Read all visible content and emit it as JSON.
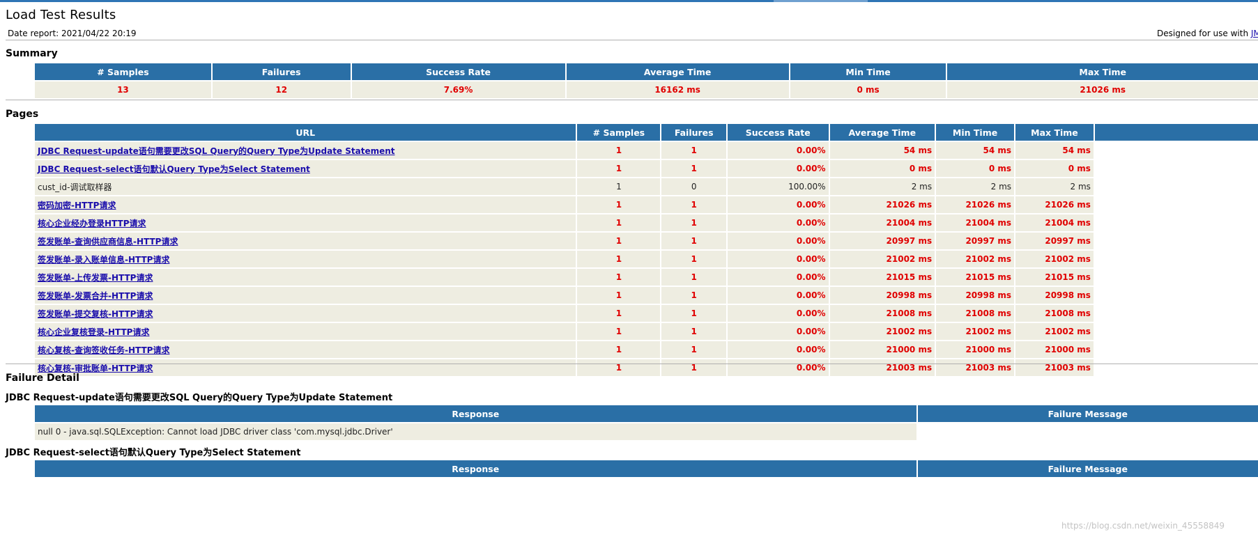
{
  "header": {
    "title": "Load Test Results",
    "date_report": "Date report: 2021/04/22 20:19",
    "designed_prefix": "Designed for use with ",
    "designed_link": "JM"
  },
  "summary": {
    "heading": "Summary",
    "columns": [
      "# Samples",
      "Failures",
      "Success Rate",
      "Average Time",
      "Min Time",
      "Max Time"
    ],
    "values": [
      "13",
      "12",
      "7.69%",
      "16162 ms",
      "0 ms",
      "21026 ms"
    ]
  },
  "pages": {
    "heading": "Pages",
    "columns": [
      "URL",
      "# Samples",
      "Failures",
      "Success Rate",
      "Average Time",
      "Min Time",
      "Max Time"
    ],
    "rows": [
      {
        "url": "JDBC Request-update语句需要更改SQL Query的Query Type为Update Statement",
        "samples": "1",
        "failures": "1",
        "success_rate": "0.00%",
        "avg": "54 ms",
        "min": "54 ms",
        "max": "54 ms",
        "failed": true
      },
      {
        "url": "JDBC Request-select语句默认Query Type为Select Statement",
        "samples": "1",
        "failures": "1",
        "success_rate": "0.00%",
        "avg": "0 ms",
        "min": "0 ms",
        "max": "0 ms",
        "failed": true
      },
      {
        "url": "cust_id-调试取样器",
        "samples": "1",
        "failures": "0",
        "success_rate": "100.00%",
        "avg": "2 ms",
        "min": "2 ms",
        "max": "2 ms",
        "failed": false
      },
      {
        "url": "密码加密-HTTP请求",
        "samples": "1",
        "failures": "1",
        "success_rate": "0.00%",
        "avg": "21026 ms",
        "min": "21026 ms",
        "max": "21026 ms",
        "failed": true
      },
      {
        "url": "核心企业经办登录HTTP请求",
        "samples": "1",
        "failures": "1",
        "success_rate": "0.00%",
        "avg": "21004 ms",
        "min": "21004 ms",
        "max": "21004 ms",
        "failed": true
      },
      {
        "url": "签发账单-查询供应商信息-HTTP请求",
        "samples": "1",
        "failures": "1",
        "success_rate": "0.00%",
        "avg": "20997 ms",
        "min": "20997 ms",
        "max": "20997 ms",
        "failed": true
      },
      {
        "url": "签发账单-录入账单信息-HTTP请求",
        "samples": "1",
        "failures": "1",
        "success_rate": "0.00%",
        "avg": "21002 ms",
        "min": "21002 ms",
        "max": "21002 ms",
        "failed": true
      },
      {
        "url": "签发账单-上传发票-HTTP请求",
        "samples": "1",
        "failures": "1",
        "success_rate": "0.00%",
        "avg": "21015 ms",
        "min": "21015 ms",
        "max": "21015 ms",
        "failed": true
      },
      {
        "url": "签发账单-发票合并-HTTP请求",
        "samples": "1",
        "failures": "1",
        "success_rate": "0.00%",
        "avg": "20998 ms",
        "min": "20998 ms",
        "max": "20998 ms",
        "failed": true
      },
      {
        "url": "签发账单-提交复核-HTTP请求",
        "samples": "1",
        "failures": "1",
        "success_rate": "0.00%",
        "avg": "21008 ms",
        "min": "21008 ms",
        "max": "21008 ms",
        "failed": true
      },
      {
        "url": "核心企业复核登录-HTTP请求",
        "samples": "1",
        "failures": "1",
        "success_rate": "0.00%",
        "avg": "21002 ms",
        "min": "21002 ms",
        "max": "21002 ms",
        "failed": true
      },
      {
        "url": "核心复核-查询签收任务-HTTP请求",
        "samples": "1",
        "failures": "1",
        "success_rate": "0.00%",
        "avg": "21000 ms",
        "min": "21000 ms",
        "max": "21000 ms",
        "failed": true
      },
      {
        "url": "核心复核-审批账单-HTTP请求",
        "samples": "1",
        "failures": "1",
        "success_rate": "0.00%",
        "avg": "21003 ms",
        "min": "21003 ms",
        "max": "21003 ms",
        "failed": true
      }
    ]
  },
  "failure_detail": {
    "heading": "Failure Detail",
    "groups": [
      {
        "title": "JDBC Request-update语句需要更改SQL Query的Query Type为Update Statement",
        "columns": [
          "Response",
          "Failure Message"
        ],
        "response": "null 0 - java.sql.SQLException: Cannot load JDBC driver class 'com.mysql.jdbc.Driver'",
        "message": ""
      },
      {
        "title": "JDBC Request-select语句默认Query Type为Select Statement",
        "columns": [
          "Response",
          "Failure Message"
        ]
      }
    ]
  },
  "watermark": "https://blog.csdn.net/weixin_45558849"
}
